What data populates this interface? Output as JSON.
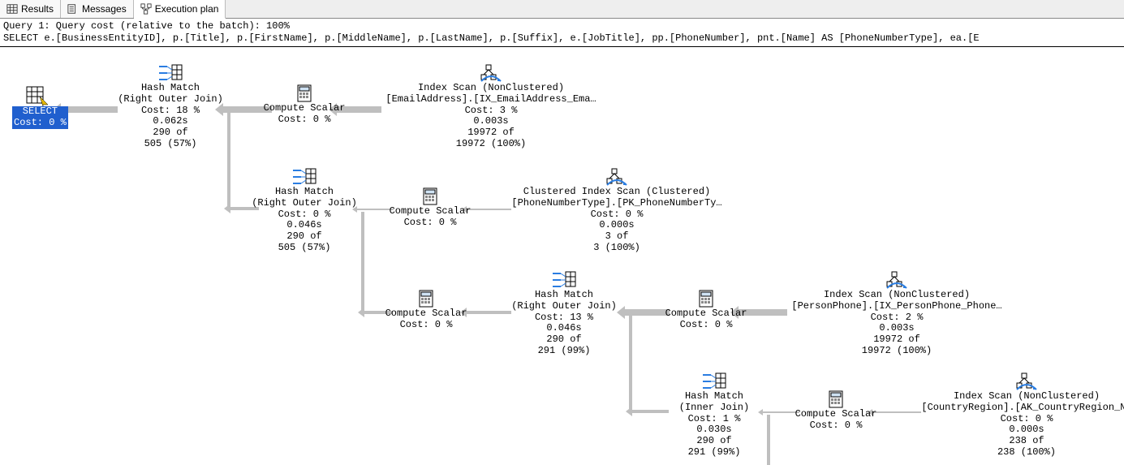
{
  "tabs": {
    "results": "Results",
    "messages": "Messages",
    "execution_plan": "Execution plan"
  },
  "query_header": {
    "line1": "Query 1: Query cost (relative to the batch): 100%",
    "line2": "SELECT e.[BusinessEntityID], p.[Title], p.[FirstName], p.[MiddleName], p.[LastName], p.[Suffix], e.[JobTitle], pp.[PhoneNumber], pnt.[Name] AS [PhoneNumberType], ea.[E"
  },
  "nodes": {
    "select": {
      "label": "SELECT",
      "cost": "Cost: 0 %"
    },
    "hash1": {
      "l1": "Hash Match",
      "l2": "(Right Outer Join)",
      "l3": "Cost: 18 %",
      "l4": "0.062s",
      "l5": "290 of",
      "l6": "505 (57%)"
    },
    "cs1": {
      "l1": "Compute Scalar",
      "l2": "Cost: 0 %"
    },
    "scan1": {
      "l1": "Index Scan (NonClustered)",
      "l2": "[EmailAddress].[IX_EmailAddress_Ema…",
      "l3": "Cost: 3 %",
      "l4": "0.003s",
      "l5": "19972 of",
      "l6": "19972 (100%)"
    },
    "hash2": {
      "l1": "Hash Match",
      "l2": "(Right Outer Join)",
      "l3": "Cost: 0 %",
      "l4": "0.046s",
      "l5": "290 of",
      "l6": "505 (57%)"
    },
    "cs2": {
      "l1": "Compute Scalar",
      "l2": "Cost: 0 %"
    },
    "scan2": {
      "l1": "Clustered Index Scan (Clustered)",
      "l2": "[PhoneNumberType].[PK_PhoneNumberTy…",
      "l3": "Cost: 0 %",
      "l4": "0.000s",
      "l5": "3 of",
      "l6": "3 (100%)"
    },
    "cs3": {
      "l1": "Compute Scalar",
      "l2": "Cost: 0 %"
    },
    "hash3": {
      "l1": "Hash Match",
      "l2": "(Right Outer Join)",
      "l3": "Cost: 13 %",
      "l4": "0.046s",
      "l5": "290 of",
      "l6": "291 (99%)"
    },
    "cs4": {
      "l1": "Compute Scalar",
      "l2": "Cost: 0 %"
    },
    "scan3": {
      "l1": "Index Scan (NonClustered)",
      "l2": "[PersonPhone].[IX_PersonPhone_Phone…",
      "l3": "Cost: 2 %",
      "l4": "0.003s",
      "l5": "19972 of",
      "l6": "19972 (100%)"
    },
    "hash4": {
      "l1": "Hash Match",
      "l2": "(Inner Join)",
      "l3": "Cost: 1 %",
      "l4": "0.030s",
      "l5": "290 of",
      "l6": "291 (99%)"
    },
    "cs5": {
      "l1": "Compute Scalar",
      "l2": "Cost: 0 %"
    },
    "scan4": {
      "l1": "Index Scan (NonClustered)",
      "l2": "[CountryRegion].[AK_CountryRegion_N…",
      "l3": "Cost: 0 %",
      "l4": "0.000s",
      "l5": "238 of",
      "l6": "238 (100%)"
    }
  }
}
